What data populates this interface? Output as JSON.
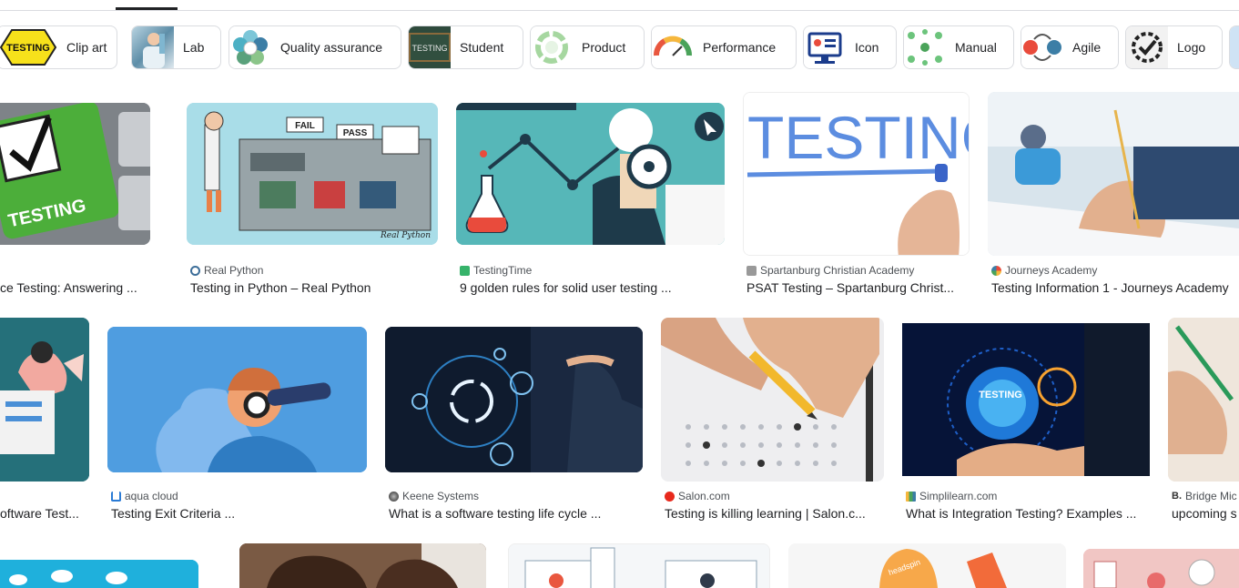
{
  "chips": [
    {
      "label": "Clip art"
    },
    {
      "label": "Lab"
    },
    {
      "label": "Quality assurance"
    },
    {
      "label": "Student"
    },
    {
      "label": "Product"
    },
    {
      "label": "Performance"
    },
    {
      "label": "Icon"
    },
    {
      "label": "Manual"
    },
    {
      "label": "Agile"
    },
    {
      "label": "Logo"
    }
  ],
  "chip_first_thumb_text": "TESTING",
  "chip_student_thumb_text": "TESTING",
  "row1": [
    {
      "source": "",
      "title": "ce Testing: Answering ...",
      "image_text": "TESTING"
    },
    {
      "source": "Real Python",
      "title": "Testing in Python – Real Python",
      "image_text_fail": "FAIL",
      "image_text_pass": "PASS",
      "image_sign": "Real Python"
    },
    {
      "source": "TestingTime",
      "title": "9 golden rules for solid user testing ..."
    },
    {
      "source": "Spartanburg Christian Academy",
      "title": "PSAT Testing – Spartanburg Christ...",
      "image_text": "TESTING"
    },
    {
      "source": "Journeys Academy",
      "title": "Testing Information 1 - Journeys Academy"
    }
  ],
  "row2": [
    {
      "source": "",
      "title": "oftware Test..."
    },
    {
      "source": "aqua cloud",
      "title": "Testing Exit Criteria ..."
    },
    {
      "source": "Keene Systems",
      "title": "What is a software testing life cycle ..."
    },
    {
      "source": "Salon.com",
      "title": "Testing is killing learning | Salon.c..."
    },
    {
      "source": "Simplilearn.com",
      "title": "What is Integration Testing? Examples ...",
      "image_text": "TESTING"
    },
    {
      "source": "Bridge Mic",
      "title": "upcoming s"
    }
  ],
  "row3_image_text": "headspin",
  "colors": {
    "divider": "#dadce0",
    "text": "#202124",
    "source": "#4d5156"
  }
}
